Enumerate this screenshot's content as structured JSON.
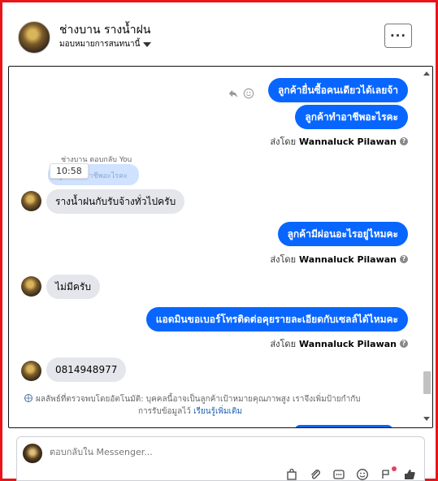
{
  "header": {
    "title": "ช่างบาน รางน้ำฝน",
    "subtitle": "มอบหมายการสนทนานี้",
    "more_label": "···"
  },
  "messages": {
    "out1": "ลูกค้ายื่นซื้อคนเดียวได้เลยจ้า",
    "out2": "ลูกค้าทำอาชีพอะไรคะ",
    "sent_by_prefix": "ส่งโดย",
    "sent_by_name": "Wannaluck Pilawan",
    "reply_hint": "ช่างบาน ตอบกลับ You",
    "quoted_text": "ลูกค้าทำอาชีพอะไรคะ",
    "timestamp": "10:58",
    "in1": "รางน้ำฝนกับรับจ้างทั่วไปครับ",
    "out3": "ลูกค้ามีผ่อนอะไรอยู่ไหมคะ",
    "in2": "ไม่มีครับ",
    "out4": "แอดมินขอเบอร์โทรติดต่อคุยรายละเอียดกับเซลล์ได้ไหมคะ",
    "in3": "0814948977"
  },
  "notice": {
    "line1": "ผลลัพธ์ที่ตรวจพบโดยอัตโนมัติ: บุคคลนี้อาจเป็นลูกค้าเป้าหมายคุณภาพสูง เราจึงเพิ่มป้ายกำกับ",
    "line2": "การรับข้อมูลไว้",
    "link": "เรียนรู้เพิ่มเติม"
  },
  "composer": {
    "placeholder": "ตอบกลับใน Messenger..."
  },
  "icons": {
    "reply": "reply-icon",
    "emoji": "emoji-icon",
    "help": "help-icon",
    "ai": "ai-sparkle-icon",
    "toolbar": [
      "bag-icon",
      "paperclip-icon",
      "saved-reply-icon",
      "emoji-icon",
      "template-icon",
      "like-icon"
    ]
  },
  "colors": {
    "accent": "#0866ff",
    "incoming_bubble": "#e4e6eb",
    "frame_border": "#e8141a"
  }
}
